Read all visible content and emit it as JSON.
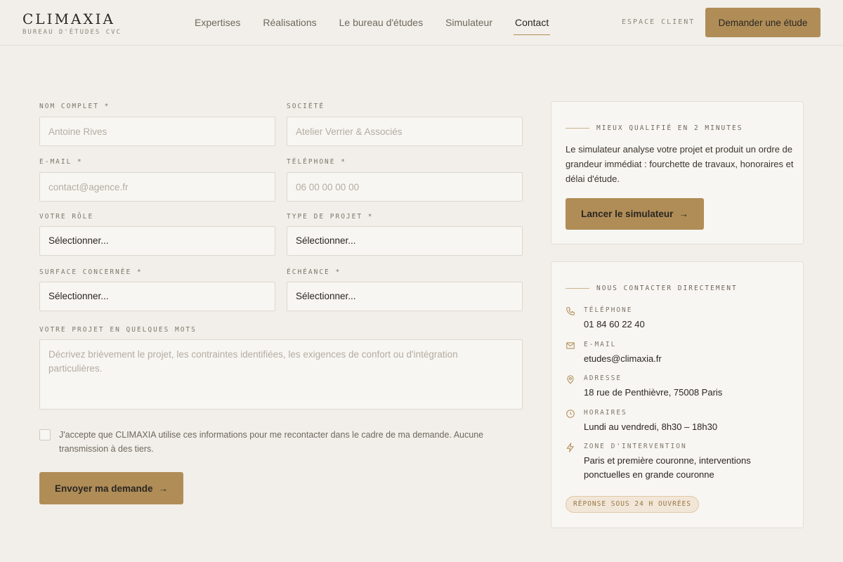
{
  "brand": {
    "name": "CLIMAXIA",
    "tagline": "BUREAU D'ÉTUDES CVC"
  },
  "nav": {
    "items": [
      {
        "label": "Expertises"
      },
      {
        "label": "Réalisations"
      },
      {
        "label": "Le bureau d'études"
      },
      {
        "label": "Simulateur"
      },
      {
        "label": "Contact"
      }
    ],
    "active": "Contact",
    "espace_client": "ESPACE CLIENT",
    "cta": "Demander une étude"
  },
  "form": {
    "nom": {
      "label": "NOM COMPLET *",
      "placeholder": "Antoine Rives"
    },
    "societe": {
      "label": "SOCIÉTÉ",
      "placeholder": "Atelier Verrier & Associés"
    },
    "email": {
      "label": "E-MAIL *",
      "placeholder": "contact@agence.fr"
    },
    "telephone": {
      "label": "TÉLÉPHONE *",
      "placeholder": "06 00 00 00 00"
    },
    "role": {
      "label": "VOTRE RÔLE",
      "value": "Sélectionner..."
    },
    "type_projet": {
      "label": "TYPE DE PROJET *",
      "value": "Sélectionner..."
    },
    "surface": {
      "label": "SURFACE CONCERNÉE *",
      "value": "Sélectionner..."
    },
    "echeance": {
      "label": "ÉCHÉANCE *",
      "value": "Sélectionner..."
    },
    "projet": {
      "label": "VOTRE PROJET EN QUELQUES MOTS",
      "placeholder": "Décrivez brièvement le projet, les contraintes identifiées, les exigences de confort ou d'intégration particulières."
    },
    "consent": "J'accepte que CLIMAXIA utilise ces informations pour me recontacter dans le cadre de ma demande. Aucune transmission à des tiers.",
    "consent_checked": false,
    "submit": "Envoyer ma demande",
    "submit_arrow": "→"
  },
  "simulator_card": {
    "eyebrow": "MIEUX QUALIFIÉ EN 2 MINUTES",
    "text": "Le simulateur analyse votre projet et produit un ordre de grandeur immédiat : fourchette de travaux, honoraires et délai d'étude.",
    "button": "Lancer le simulateur",
    "button_arrow": "→"
  },
  "contact_card": {
    "eyebrow": "NOUS CONTACTER DIRECTEMENT",
    "items": [
      {
        "icon": "phone-icon",
        "label": "TÉLÉPHONE",
        "value": "01 84 60 22 40"
      },
      {
        "icon": "mail-icon",
        "label": "E-MAIL",
        "value": "etudes@climaxia.fr"
      },
      {
        "icon": "map-pin-icon",
        "label": "ADRESSE",
        "value": "18 rue de Penthièvre, 75008 Paris"
      },
      {
        "icon": "clock-icon",
        "label": "HORAIRES",
        "value": "Lundi au vendredi, 8h30 – 18h30"
      },
      {
        "icon": "lightning-icon",
        "label": "ZONE D'INTERVENTION",
        "value": "Paris et première couronne, interventions ponctuelles en grande couronne"
      }
    ],
    "badge": "RÉPONSE SOUS 24 H OUVRÉES"
  },
  "colors": {
    "accent": "#b08d57",
    "background": "#f2efea",
    "card": "#f8f6f2",
    "text": "#2a2622"
  }
}
